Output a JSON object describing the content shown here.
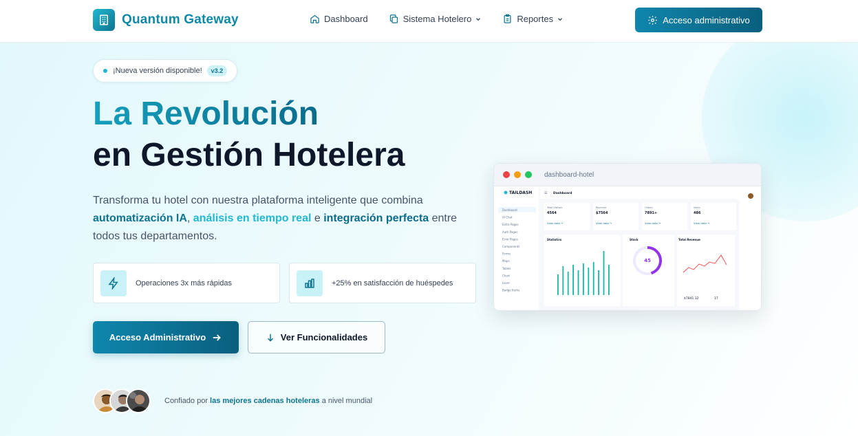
{
  "header": {
    "brand": "Quantum Gateway",
    "nav": [
      {
        "label": "Dashboard",
        "icon": "home-icon"
      },
      {
        "label": "Sistema Hotelero",
        "icon": "copy-icon",
        "dropdown": true
      },
      {
        "label": "Reportes",
        "icon": "clipboard-icon",
        "dropdown": true
      }
    ],
    "admin_button": "Acceso administrativo"
  },
  "hero": {
    "badge_text": "¡Nueva versión disponible!",
    "badge_version": "v3.2",
    "title_line1": "La Revolución",
    "title_line2": "en Gestión Hotelera",
    "desc_part1": "Transforma tu hotel con nuestra plataforma inteligente que combina ",
    "desc_hl1": "automatización IA",
    "desc_sep1": ", ",
    "desc_hl2": "análisis en tiempo real",
    "desc_sep2": " e ",
    "desc_hl3": "integración perfecta",
    "desc_part2": " entre todos tus departamentos.",
    "features": [
      {
        "text": "Operaciones 3x más rápidas",
        "icon": "lightning-icon"
      },
      {
        "text": "+25% en satisfacción de huéspedes",
        "icon": "bar-chart-icon"
      }
    ],
    "cta_primary": "Acceso Administrativo",
    "cta_secondary": "Ver Funcionalidades",
    "trust_prefix": "Confiado por ",
    "trust_strong": "las mejores cadenas hoteleras",
    "trust_suffix": " a nivel mundial"
  },
  "mockup": {
    "window_title": "dashboard-hotel",
    "app_name": "TAILDASH",
    "page_title": "Dashboard",
    "sidebar": [
      "Dashboard",
      "AI Chat",
      "Extra Pages",
      "Auth Pages",
      "Error Pages",
      "Components",
      "Forms",
      "Maps",
      "Tables",
      "Chart",
      "Level",
      "Badge Items"
    ],
    "stats": [
      {
        "label": "Total Visitors",
        "value": "4564"
      },
      {
        "label": "Revenue",
        "value": "$7564"
      },
      {
        "label": "Orders",
        "value": "7891+"
      },
      {
        "label": "Users",
        "value": "486"
      }
    ],
    "link": "View data",
    "panels": [
      "Statistics",
      "Stock",
      "Total Revenue"
    ],
    "gauge_value": "45",
    "revenue_value": "$7841.12",
    "revenue_count": "17",
    "colors": {
      "accent": "#0e7490",
      "bars": "#14b8a6",
      "gauge": "#9333ea",
      "line": "#ef4444"
    }
  }
}
